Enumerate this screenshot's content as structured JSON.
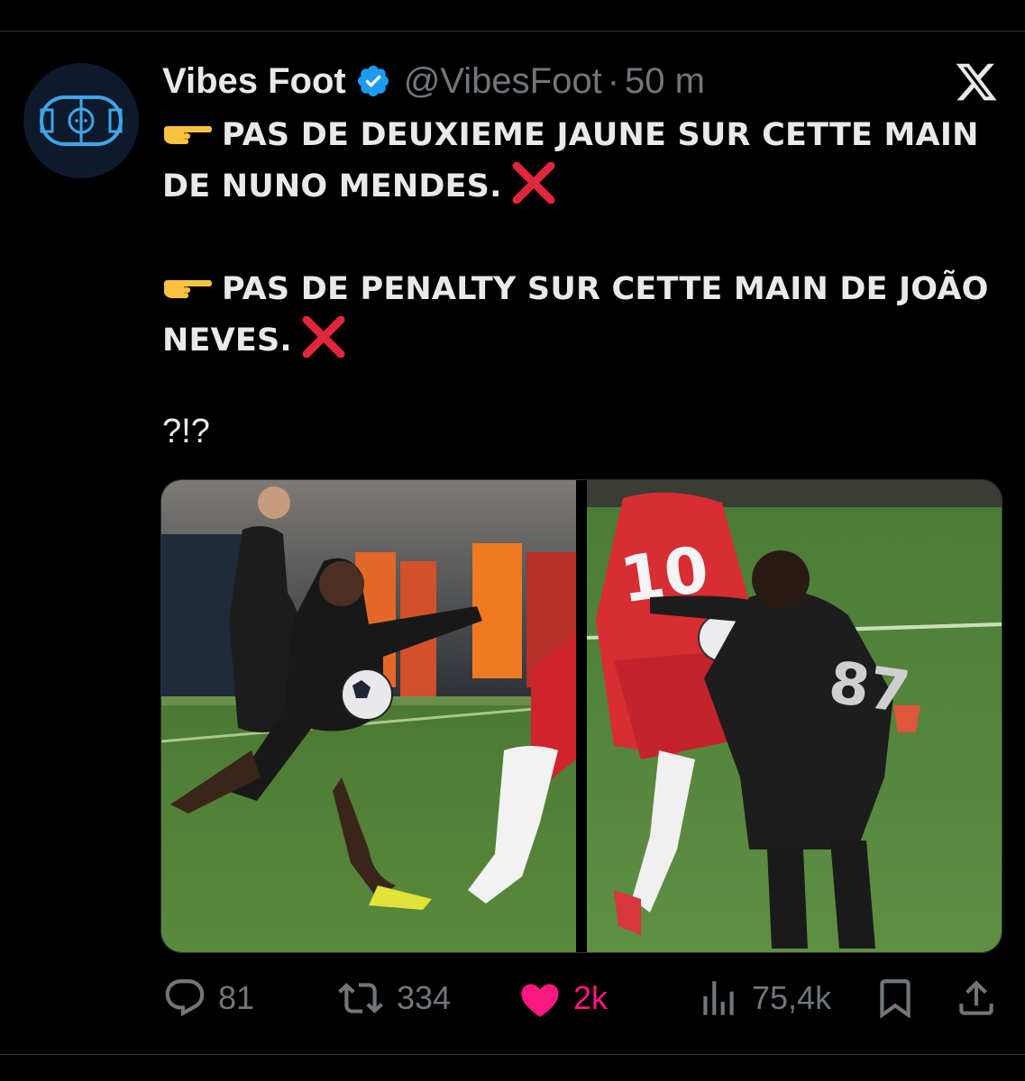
{
  "tweet": {
    "author": {
      "display_name": "Vibes Foot",
      "handle": "@VibesFoot",
      "separator": "·",
      "timestamp": "50 m",
      "verified": true
    },
    "paragraphs": [
      {
        "text": "PAS DE DEUXIEME JAUNE SUR CETTE MAIN DE NUNO MENDES.",
        "lead_emoji": "backhand-index-pointing-right",
        "trail_emoji": "cross-mark"
      },
      {
        "text": "PAS DE PENALTY SUR CETTE MAIN DE JOÃO NEVES.",
        "lead_emoji": "backhand-index-pointing-right",
        "trail_emoji": "cross-mark"
      }
    ],
    "closing": "?!?",
    "media": [
      {
        "alt": ""
      },
      {
        "alt": ""
      }
    ],
    "metrics": {
      "replies": "81",
      "reposts": "334",
      "likes": "2k",
      "views": "75,4k"
    },
    "liked": true,
    "colors": {
      "background": "#000000",
      "text": "#e7e9ea",
      "muted": "#71767b",
      "verified": "#1d9bf0",
      "like": "#f91880"
    }
  }
}
